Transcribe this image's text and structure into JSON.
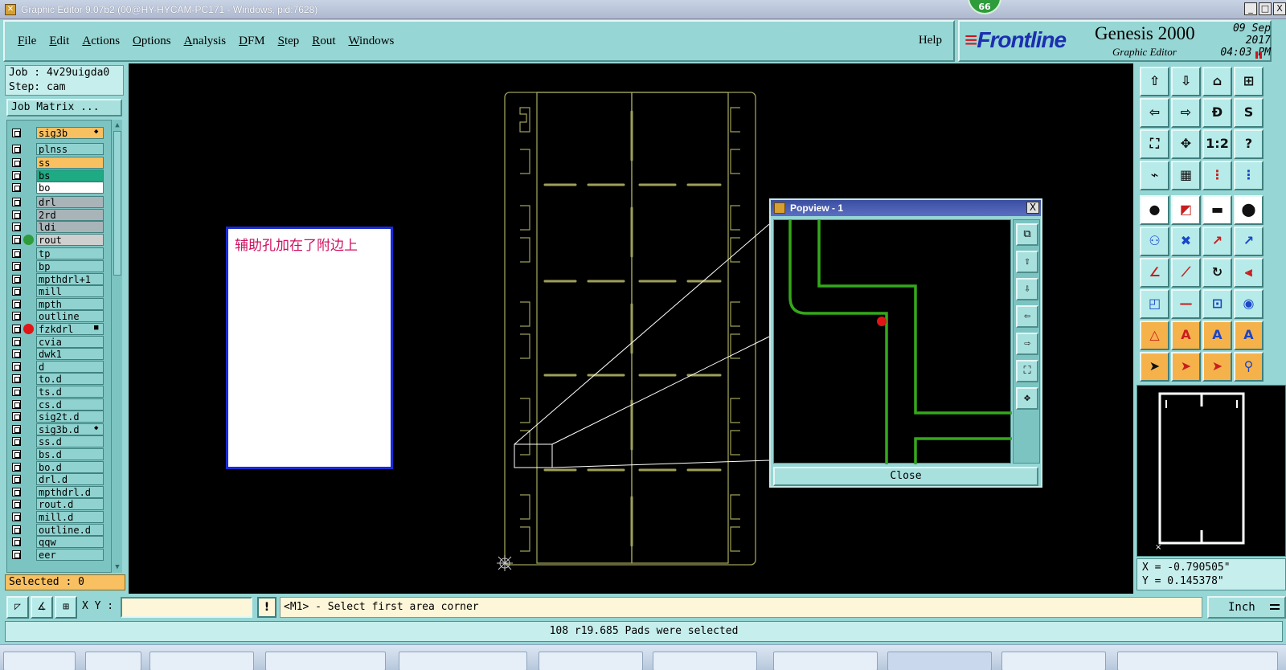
{
  "window": {
    "title": "Graphic Editor 9.07b2 (00@HY-HYCAM-PC171 - Windows, pid:7628)",
    "badge": "66",
    "minimize": "_",
    "maximize": "□",
    "close": "X"
  },
  "menu": {
    "items": [
      {
        "first": "F",
        "rest": "ile"
      },
      {
        "first": "E",
        "rest": "dit"
      },
      {
        "first": "A",
        "rest": "ctions"
      },
      {
        "first": "O",
        "rest": "ptions"
      },
      {
        "first": "A",
        "rest": "nalysis"
      },
      {
        "first": "D",
        "rest": "FM"
      },
      {
        "first": "S",
        "rest": "tep"
      },
      {
        "first": "R",
        "rest": "out"
      },
      {
        "first": "W",
        "rest": "indows"
      }
    ],
    "help": "Help"
  },
  "logo": {
    "brand": "Frontline",
    "product": "Genesis 2000",
    "subtitle": "Graphic Editor",
    "date": "09 Sep 2017",
    "time": "04:03 PM"
  },
  "job": {
    "job_line": "Job : 4v29uigda0",
    "step_line": "Step: cam",
    "matrix_button": "Job Matrix ..."
  },
  "layers": [
    {
      "name": "sig3b",
      "bg": "#f8c060",
      "dot": "",
      "mark": "◆"
    },
    {
      "name": "plnss",
      "bg": "#8fd2cf",
      "dot": "",
      "mark": ""
    },
    {
      "name": "ss",
      "bg": "#f8c060",
      "dot": "",
      "mark": ""
    },
    {
      "name": "bs",
      "bg": "#1eaa82",
      "dot": "",
      "mark": ""
    },
    {
      "name": "bo",
      "bg": "#ffffff",
      "dot": "",
      "mark": ""
    },
    {
      "name": "drl",
      "bg": "#a8b4b8",
      "dot": "",
      "mark": ""
    },
    {
      "name": "2rd",
      "bg": "#a8b4b8",
      "dot": "",
      "mark": ""
    },
    {
      "name": "ldi",
      "bg": "#a8b4b8",
      "dot": "",
      "mark": ""
    },
    {
      "name": "rout",
      "bg": "#cfcfcf",
      "dot": "#2e9c3a",
      "mark": ""
    },
    {
      "name": "tp",
      "bg": "#8fd2cf",
      "dot": "",
      "mark": ""
    },
    {
      "name": "bp",
      "bg": "#8fd2cf",
      "dot": "",
      "mark": ""
    },
    {
      "name": "mpthdrl+1",
      "bg": "#8fd2cf",
      "dot": "",
      "mark": ""
    },
    {
      "name": "mill",
      "bg": "#8fd2cf",
      "dot": "",
      "mark": ""
    },
    {
      "name": "mpth",
      "bg": "#8fd2cf",
      "dot": "",
      "mark": ""
    },
    {
      "name": "outline",
      "bg": "#8fd2cf",
      "dot": "",
      "mark": ""
    },
    {
      "name": "fzkdrl",
      "bg": "#8fd2cf",
      "dot": "#e01515",
      "mark": "■"
    },
    {
      "name": "cvia",
      "bg": "#8fd2cf",
      "dot": "",
      "mark": ""
    },
    {
      "name": "dwk1",
      "bg": "#8fd2cf",
      "dot": "",
      "mark": ""
    },
    {
      "name": "d",
      "bg": "#8fd2cf",
      "dot": "",
      "mark": ""
    },
    {
      "name": "to.d",
      "bg": "#8fd2cf",
      "dot": "",
      "mark": ""
    },
    {
      "name": "ts.d",
      "bg": "#8fd2cf",
      "dot": "",
      "mark": ""
    },
    {
      "name": "cs.d",
      "bg": "#8fd2cf",
      "dot": "",
      "mark": ""
    },
    {
      "name": "sig2t.d",
      "bg": "#8fd2cf",
      "dot": "",
      "mark": ""
    },
    {
      "name": "sig3b.d",
      "bg": "#8fd2cf",
      "dot": "",
      "mark": "◆"
    },
    {
      "name": "ss.d",
      "bg": "#8fd2cf",
      "dot": "",
      "mark": ""
    },
    {
      "name": "bs.d",
      "bg": "#8fd2cf",
      "dot": "",
      "mark": ""
    },
    {
      "name": "bo.d",
      "bg": "#8fd2cf",
      "dot": "",
      "mark": ""
    },
    {
      "name": "drl.d",
      "bg": "#8fd2cf",
      "dot": "",
      "mark": ""
    },
    {
      "name": "mpthdrl.d",
      "bg": "#8fd2cf",
      "dot": "",
      "mark": ""
    },
    {
      "name": "rout.d",
      "bg": "#8fd2cf",
      "dot": "",
      "mark": ""
    },
    {
      "name": "mill.d",
      "bg": "#8fd2cf",
      "dot": "",
      "mark": ""
    },
    {
      "name": "outline.d",
      "bg": "#8fd2cf",
      "dot": "",
      "mark": ""
    },
    {
      "name": "qqw",
      "bg": "#8fd2cf",
      "dot": "",
      "mark": ""
    },
    {
      "name": "eer",
      "bg": "#8fd2cf",
      "dot": "",
      "mark": ""
    }
  ],
  "selected": "Selected : 0",
  "note": "辅助孔加在了附边上",
  "popview": {
    "title": "Popview - 1",
    "close_x": "X",
    "close": "Close"
  },
  "coords": {
    "x": "X = -0.790505\"",
    "y": "Y = 0.145378\""
  },
  "command": {
    "xy_label": "X Y :",
    "xy_value": "",
    "warn": "!",
    "prompt": "<M1> - Select first area corner",
    "units": "Inch"
  },
  "status": "108 r19.685 Pads were selected",
  "colors": {
    "panel": "#96d6d4",
    "board_outline": "#9ea05a",
    "popview_trace": "#34a81a",
    "highlight_pad": "#e01515",
    "note_text": "#d01060",
    "note_border": "#1a2bd6"
  }
}
